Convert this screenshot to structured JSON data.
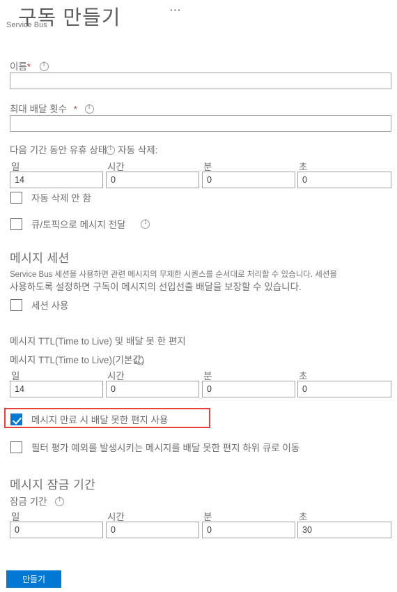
{
  "header": {
    "title": "구독 만들기",
    "subtitle": "Service Bus",
    "more_menu": "⋯"
  },
  "form": {
    "name": {
      "label": "이름",
      "required_marker": "*",
      "value": "",
      "placeholder": ""
    },
    "max_delivery_count": {
      "label": "최대 배달 횟수",
      "required_marker": "*",
      "value": "",
      "placeholder": ""
    },
    "auto_delete_idle": {
      "label_prefix": "다음 기간 동안 유휴 상태",
      "label_suffix": "자동 삭제:",
      "columns": [
        "일",
        "시간",
        "분",
        "초"
      ],
      "values": [
        "14",
        "0",
        "0",
        "0"
      ]
    },
    "never_auto_delete_checkbox": {
      "label": "자동 삭제 안 함",
      "checked": false
    },
    "forward_messages_checkbox": {
      "label": "큐/토픽으로 메시지 전달",
      "checked": false
    },
    "message_sessions": {
      "heading": "메시지 세션",
      "description_line1": "Service Bus 세션을 사용하면 관련 메시지의 무제한 시퀀스를 순서대로 처리할 수 있습니다. 세션을",
      "description_line2": "사용하도록 설정하면 구독이 메시지의 선입선출 배달을 보장할 수 있습니다.",
      "enable_sessions_checkbox": {
        "label": "세션 사용",
        "checked": false
      }
    },
    "message_ttl": {
      "heading": "메시지 TTL(Time to Live) 및 배달 못 한 편지",
      "sub_label": "메시지 TTL(Time to Live)(기본값)",
      "columns": [
        "일",
        "시간",
        "분",
        "초"
      ],
      "values": [
        "14",
        "0",
        "0",
        "0"
      ]
    },
    "dead_letter_on_expiration_checkbox": {
      "label": "메시지 만료 시 배달 못한 편지 사용",
      "checked": true,
      "highlight_color": "#e8413a"
    },
    "dead_letter_on_filter_checkbox": {
      "label": "필터 평가 예외를 발생시키는 메시지를 배달 못한 편지 하위 큐로 이동",
      "checked": false
    },
    "message_lock": {
      "heading": "메시지 잠금 기간",
      "sub_label": "잠금 기간",
      "columns": [
        "일",
        "시간",
        "분",
        "초"
      ],
      "values": [
        "0",
        "0",
        "0",
        "30"
      ]
    }
  },
  "footer": {
    "create_button": "만들기"
  },
  "colors": {
    "accent": "#0078d4",
    "highlight": "#e8413a",
    "text": "#6e6e6e",
    "border": "#a3a3a3"
  }
}
